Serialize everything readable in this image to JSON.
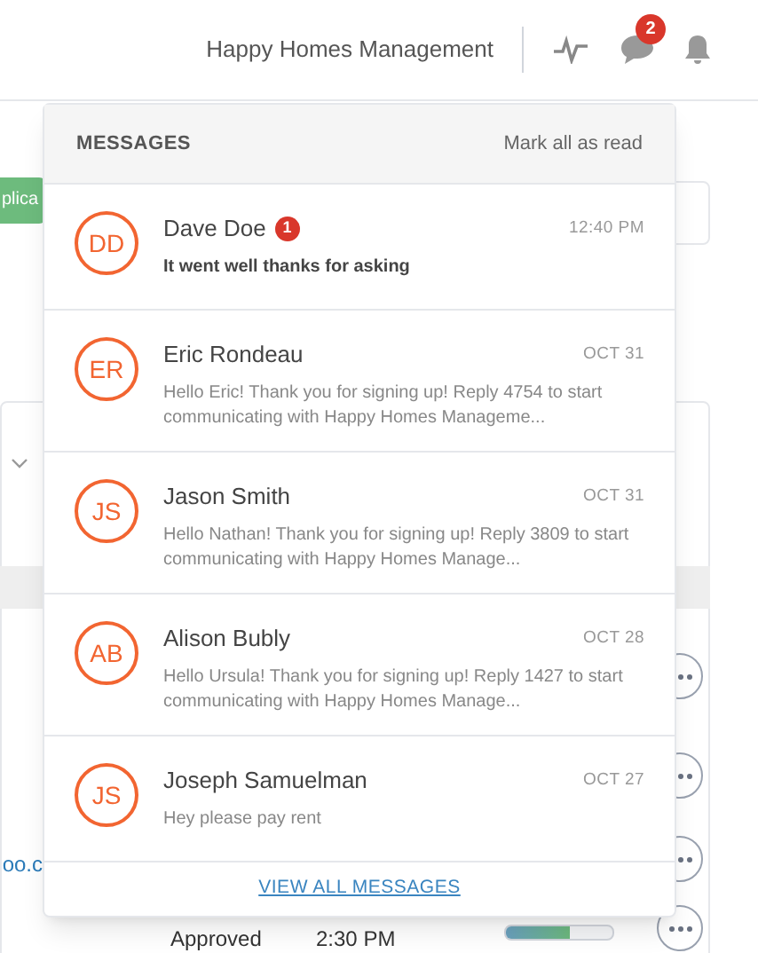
{
  "header": {
    "company": "Happy Homes Management",
    "message_count": "2"
  },
  "background": {
    "button": "plica",
    "link": "oo.c",
    "status": "Approved",
    "time": "2:30 PM",
    "progress": {
      "level": 0.6
    }
  },
  "messages_panel": {
    "title": "MESSAGES",
    "mark_all": "Mark all as read",
    "messages": [
      {
        "initials": "DD",
        "name": "Dave Doe",
        "unread": true,
        "unread_count": "1",
        "time": "12:40 PM",
        "text": "It went well thanks for asking"
      },
      {
        "initials": "ER",
        "name": "Eric Rondeau",
        "unread": false,
        "time": "OCT 31",
        "text": "Hello Eric! Thank you for signing up! Reply 4754 to start communicating with Happy Homes Manageme..."
      },
      {
        "initials": "JS",
        "name": "Jason Smith",
        "unread": false,
        "time": "OCT 31",
        "text": "Hello Nathan! Thank you for signing up! Reply 3809 to start communicating with Happy Homes Manage..."
      },
      {
        "initials": "AB",
        "name": "Alison Bubly",
        "unread": false,
        "time": "OCT 28",
        "text": "Hello Ursula! Thank you for signing up! Reply 1427 to start communicating with Happy Homes Manage..."
      },
      {
        "initials": "JS",
        "name": "Joseph Samuelman",
        "unread": false,
        "time": "OCT 27",
        "text": "Hey please pay rent"
      }
    ],
    "view_all": "VIEW ALL MESSAGES"
  }
}
